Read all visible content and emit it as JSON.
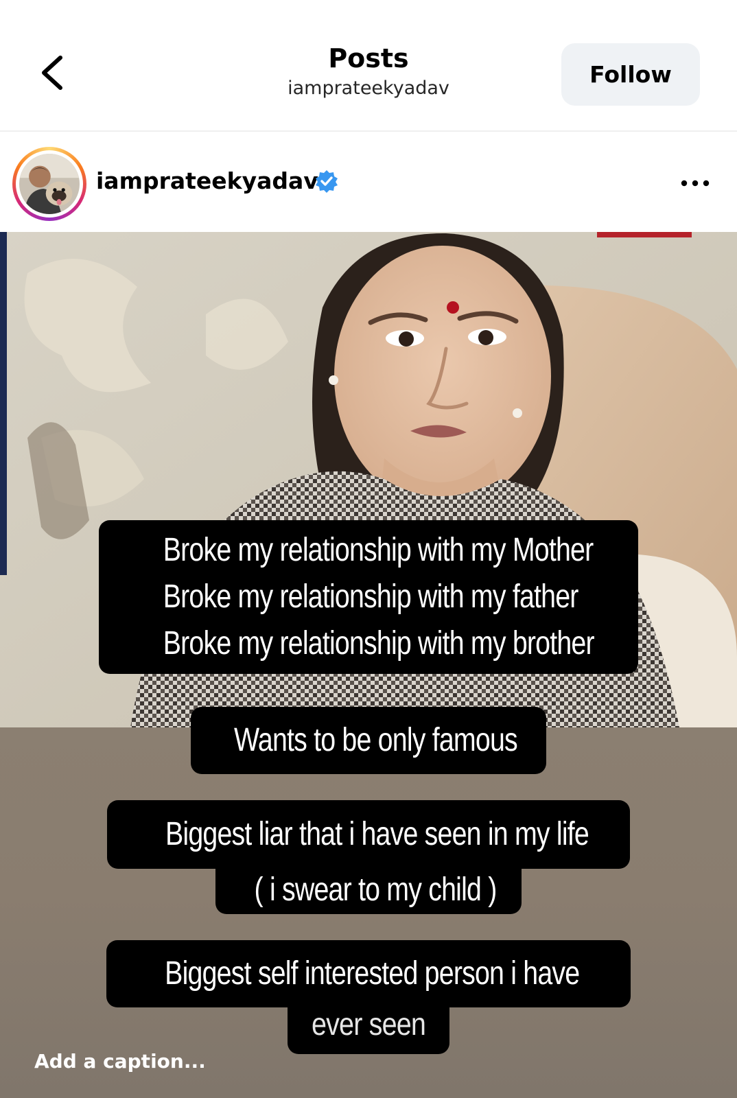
{
  "header": {
    "title": "Posts",
    "subtitle": "iamprateekyadav",
    "follow_label": "Follow",
    "back_icon": "chevron-left-icon"
  },
  "post": {
    "username": "iamprateekyadav",
    "verified": true,
    "verified_color": "#3897f0",
    "more_icon": "more-horizontal-icon"
  },
  "overlays": {
    "block1": [
      "Broke my relationship with my Mother",
      "Broke my relationship with my father",
      "Broke my relationship with my brother"
    ],
    "block2": "Wants to be only famous",
    "block3_line1": "Biggest liar that i have seen in my life",
    "block3_line2": "( i swear to my child )",
    "block4_line1": "Biggest self interested person i have",
    "block4_line2": "ever seen"
  },
  "caption_placeholder": "Add a caption..."
}
